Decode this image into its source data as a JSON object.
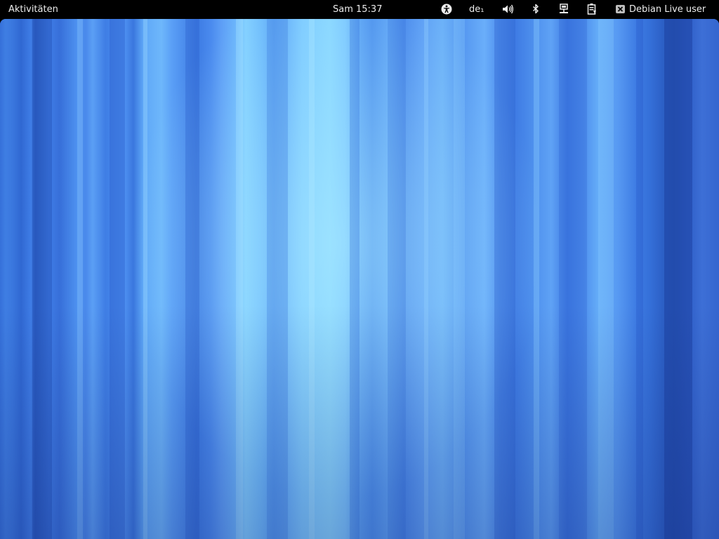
{
  "panel": {
    "activities_label": "Aktivitäten",
    "clock": "Sam 15:37",
    "keyboard_layout": "de₁",
    "user_name": "Debian Live user"
  },
  "icons": {
    "accessibility": "accessibility-icon",
    "volume": "volume-icon",
    "bluetooth": "bluetooth-icon",
    "network": "network-wired-icon",
    "power": "battery-icon",
    "user_status": "user-status-busy-icon"
  },
  "colors": {
    "panel_background": "#000000",
    "panel_text": "#ececec",
    "wallpaper_base": "#3f77dd",
    "wallpaper_highlight": "#8ad7ff"
  }
}
